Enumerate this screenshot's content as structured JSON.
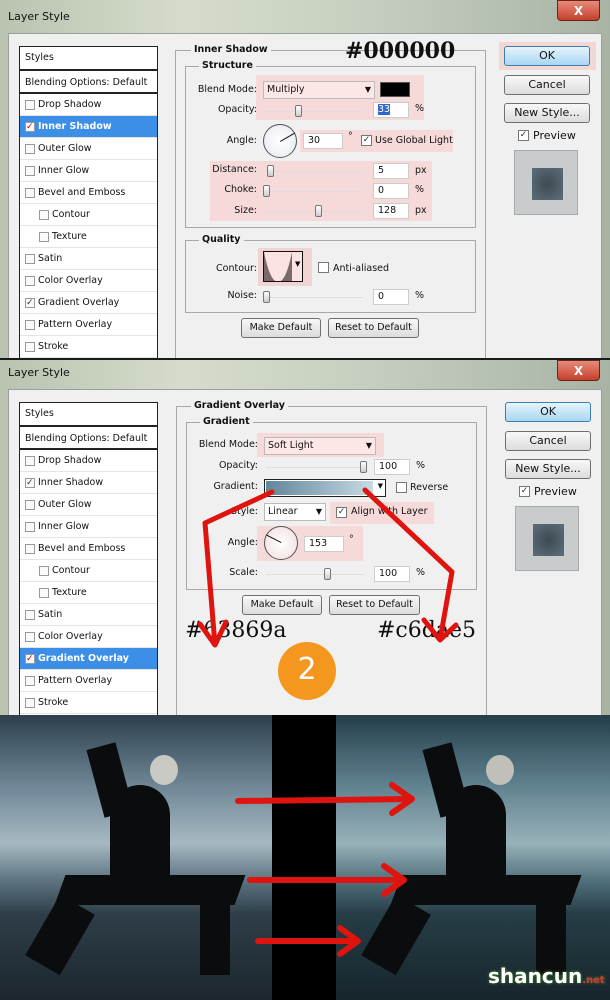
{
  "dialog1": {
    "title": "Layer Style",
    "close": "X",
    "styles_header": "Styles",
    "blending": "Blending Options: Default",
    "items": [
      {
        "label": "Drop Shadow",
        "checked": false
      },
      {
        "label": "Inner Shadow",
        "checked": true,
        "selected": true
      },
      {
        "label": "Outer Glow",
        "checked": false
      },
      {
        "label": "Inner Glow",
        "checked": false
      },
      {
        "label": "Bevel and Emboss",
        "checked": false
      },
      {
        "label": "Contour",
        "checked": false,
        "sub": true
      },
      {
        "label": "Texture",
        "checked": false,
        "sub": true
      },
      {
        "label": "Satin",
        "checked": false
      },
      {
        "label": "Color Overlay",
        "checked": false
      },
      {
        "label": "Gradient Overlay",
        "checked": true
      },
      {
        "label": "Pattern Overlay",
        "checked": false
      },
      {
        "label": "Stroke",
        "checked": false
      }
    ],
    "group_title": "Inner Shadow",
    "annotation": "#000000",
    "structure": "Structure",
    "blend_label": "Blend Mode:",
    "blend_value": "Multiply",
    "shadow_color": "#000000",
    "opacity_label": "Opacity:",
    "opacity": "33",
    "opacity_unit": "%",
    "angle_label": "Angle:",
    "angle": "30",
    "deg": "°",
    "global_light": "Use Global Light",
    "global_light_checked": true,
    "distance_label": "Distance:",
    "distance": "5",
    "distance_unit": "px",
    "choke_label": "Choke:",
    "choke": "0",
    "choke_unit": "%",
    "size_label": "Size:",
    "size": "128",
    "size_unit": "px",
    "quality": "Quality",
    "contour_label": "Contour:",
    "anti_aliased": "Anti-aliased",
    "noise_label": "Noise:",
    "noise": "0",
    "noise_unit": "%",
    "make_default": "Make Default",
    "reset_default": "Reset to Default",
    "ok": "OK",
    "cancel": "Cancel",
    "new_style": "New Style...",
    "preview": "Preview"
  },
  "dialog2": {
    "title": "Layer Style",
    "close": "X",
    "styles_header": "Styles",
    "blending": "Blending Options: Default",
    "items": [
      {
        "label": "Drop Shadow",
        "checked": false
      },
      {
        "label": "Inner Shadow",
        "checked": true
      },
      {
        "label": "Outer Glow",
        "checked": false
      },
      {
        "label": "Inner Glow",
        "checked": false
      },
      {
        "label": "Bevel and Emboss",
        "checked": false
      },
      {
        "label": "Contour",
        "checked": false,
        "sub": true
      },
      {
        "label": "Texture",
        "checked": false,
        "sub": true
      },
      {
        "label": "Satin",
        "checked": false
      },
      {
        "label": "Color Overlay",
        "checked": false
      },
      {
        "label": "Gradient Overlay",
        "checked": true,
        "selected": true
      },
      {
        "label": "Pattern Overlay",
        "checked": false
      },
      {
        "label": "Stroke",
        "checked": false
      }
    ],
    "group_title": "Gradient Overlay",
    "gradient_section": "Gradient",
    "blend_label": "Blend Mode:",
    "blend_value": "Soft Light",
    "opacity_label": "Opacity:",
    "opacity": "100",
    "opacity_unit": "%",
    "gradient_label": "Gradient:",
    "reverse": "Reverse",
    "style_label": "Style:",
    "style_value": "Linear",
    "align": "Align with Layer",
    "align_checked": true,
    "angle_label": "Angle:",
    "angle": "153",
    "deg": "°",
    "scale_label": "Scale:",
    "scale": "100",
    "scale_unit": "%",
    "make_default": "Make Default",
    "reset_default": "Reset to Default",
    "ok": "OK",
    "cancel": "Cancel",
    "new_style": "New Style...",
    "preview": "Preview",
    "color_start": "#63869a",
    "color_end": "#c6dae5",
    "step": "2"
  },
  "colors": {
    "selection": "#3d8ee6",
    "arrow": "#e0140f",
    "step_badge": "#f5961e"
  },
  "watermark": {
    "brand": "shancun",
    "suffix": ".net"
  }
}
